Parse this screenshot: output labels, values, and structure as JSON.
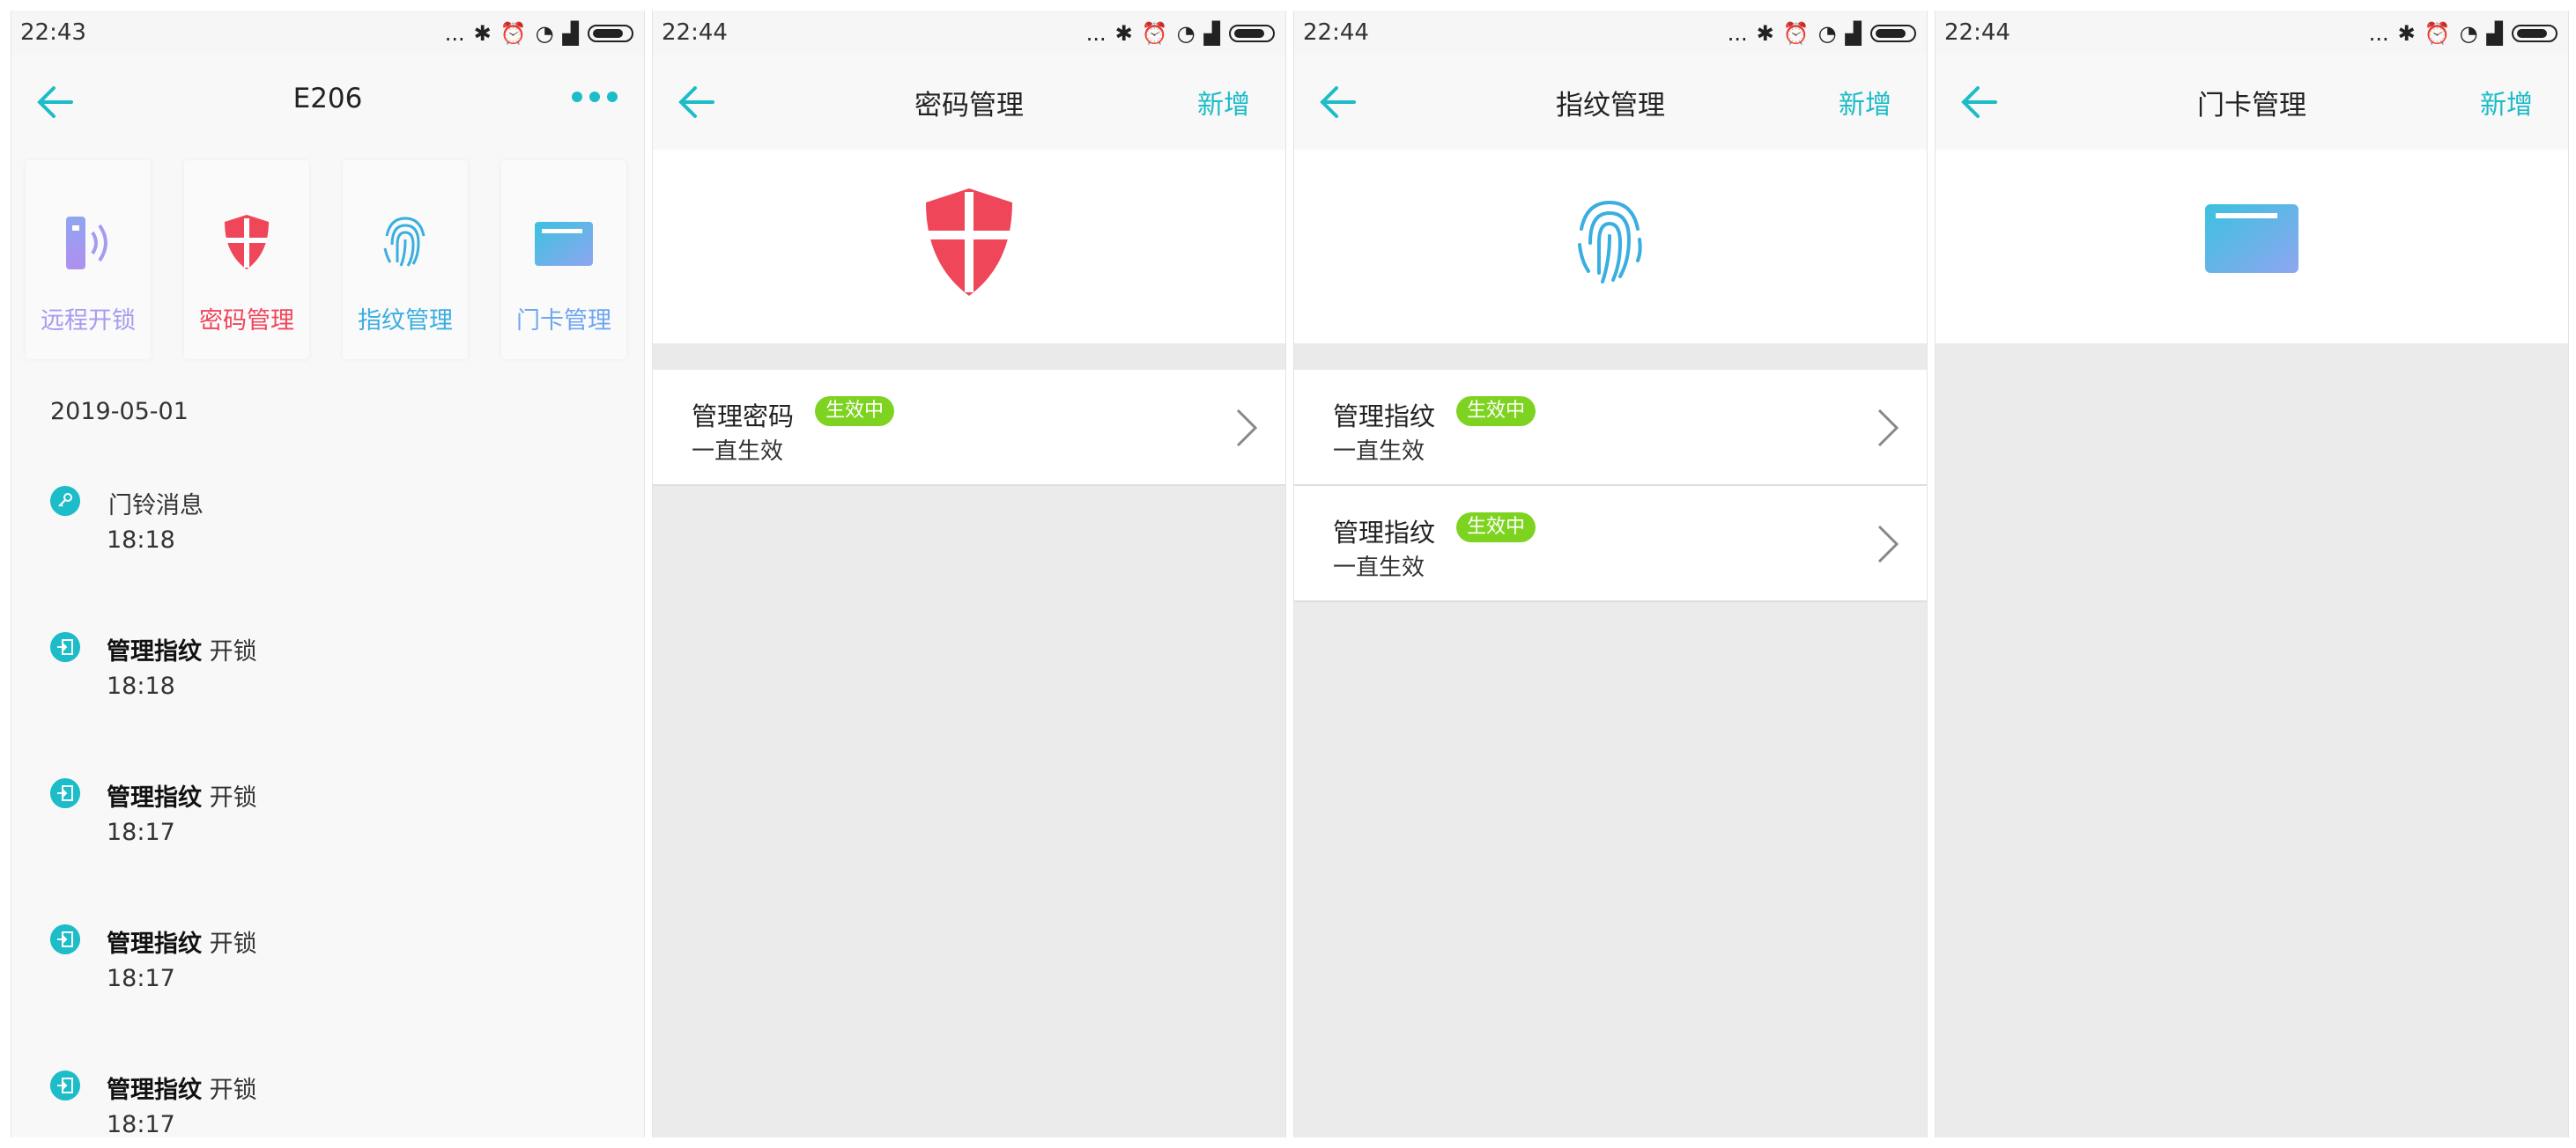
{
  "screens": [
    {
      "time": "22:43",
      "title": "E206",
      "features": [
        {
          "label": "远程开锁",
          "color": "#a59cf0"
        },
        {
          "label": "密码管理",
          "color": "#f0465a"
        },
        {
          "label": "指纹管理",
          "color": "#3aaee0"
        },
        {
          "label": "门卡管理",
          "color": "#6ea6f0"
        }
      ],
      "date": "2019-05-01",
      "logs": [
        {
          "title": "门铃消息",
          "action": "",
          "time": "18:18",
          "icon": "key-icon"
        },
        {
          "title": "管理指纹",
          "action": "开锁",
          "time": "18:18",
          "icon": "login-icon"
        },
        {
          "title": "管理指纹",
          "action": "开锁",
          "time": "18:17",
          "icon": "login-icon"
        },
        {
          "title": "管理指纹",
          "action": "开锁",
          "time": "18:17",
          "icon": "login-icon"
        },
        {
          "title": "管理指纹",
          "action": "开锁",
          "time": "18:17",
          "icon": "login-icon"
        }
      ]
    },
    {
      "time": "22:44",
      "title": "密码管理",
      "action": "新增",
      "rows": [
        {
          "title": "管理密码",
          "badge": "生效中",
          "subtitle": "一直生效"
        }
      ]
    },
    {
      "time": "22:44",
      "title": "指纹管理",
      "action": "新增",
      "rows": [
        {
          "title": "管理指纹",
          "badge": "生效中",
          "subtitle": "一直生效"
        },
        {
          "title": "管理指纹",
          "badge": "生效中",
          "subtitle": "一直生效"
        }
      ]
    },
    {
      "time": "22:44",
      "title": "门卡管理",
      "action": "新增",
      "rows": []
    }
  ],
  "statusbar": {
    "dots": "...",
    "signal_icon": "signal-icon",
    "wifi_icon": "wifi-icon",
    "alarm_icon": "alarm-icon",
    "bluetooth_icon": "bluetooth-icon",
    "battery_icon": "battery-icon"
  },
  "colors": {
    "accent": "#1cbcc8",
    "badge": "#7ed321",
    "shield": "#f0465a",
    "fingerprint": "#3aaee0",
    "card": "#5fb8e8"
  }
}
